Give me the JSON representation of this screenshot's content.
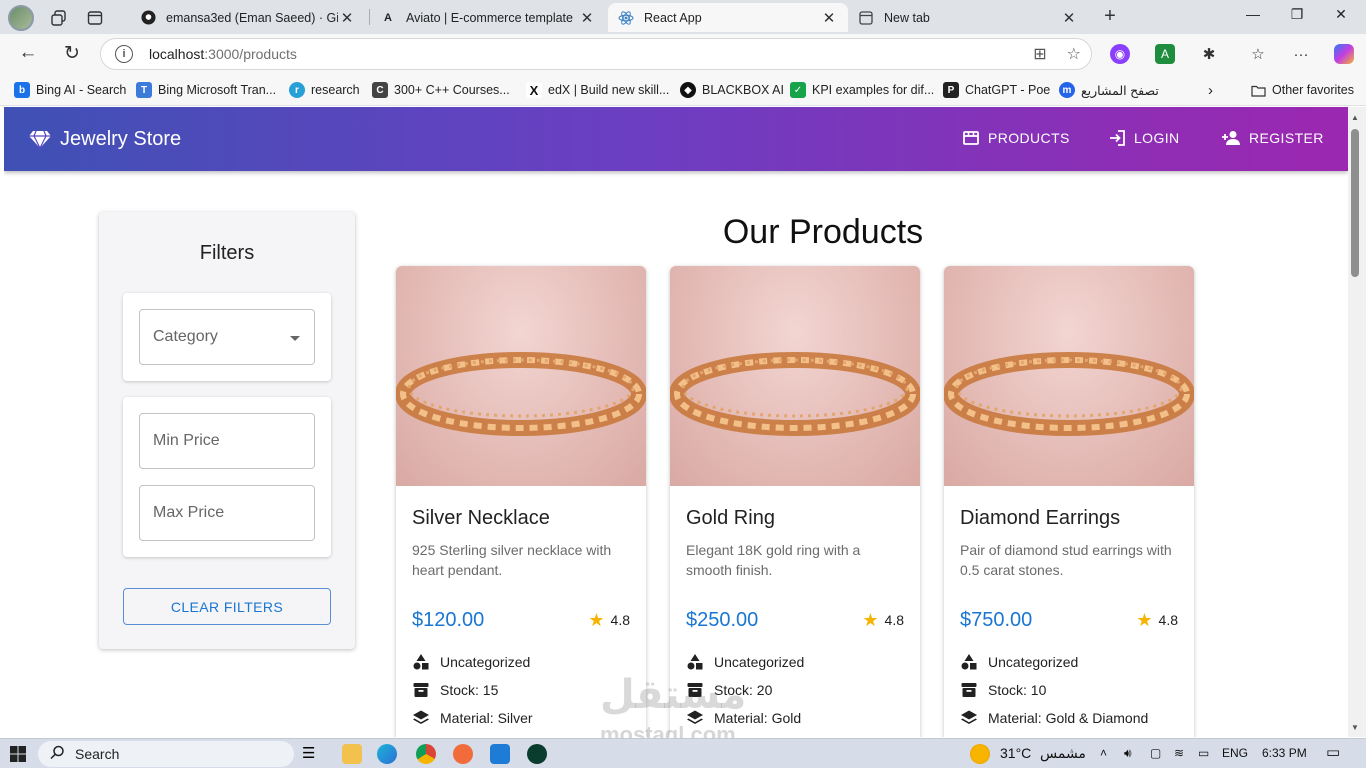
{
  "browser": {
    "tabs": [
      {
        "title": "emansa3ed (Eman Saeed) · GitHub",
        "favicon": "github-icon"
      },
      {
        "title": "Aviato | E-commerce template",
        "favicon": "aviato-icon"
      },
      {
        "title": "React App",
        "favicon": "react-icon",
        "active": true
      },
      {
        "title": "New tab",
        "favicon": "newtab-icon"
      }
    ],
    "url_host": "localhost",
    "url_path": ":3000/products",
    "favorites": [
      {
        "label": "Bing AI - Search",
        "icon": "bing-icon"
      },
      {
        "label": "Bing Microsoft Tran...",
        "icon": "translator-icon"
      },
      {
        "label": "research",
        "icon": "research-icon"
      },
      {
        "label": "300+ C++ Courses...",
        "icon": "courses-icon"
      },
      {
        "label": "edX | Build new skill...",
        "icon": "edx-icon"
      },
      {
        "label": "BLACKBOX AI",
        "icon": "blackbox-icon"
      },
      {
        "label": "KPI examples for dif...",
        "icon": "kpi-icon"
      },
      {
        "label": "ChatGPT - Poe",
        "icon": "poe-icon"
      },
      {
        "label": "تصفح المشاريع",
        "icon": "mostaql-icon"
      }
    ],
    "other_favorites": "Other favorites"
  },
  "app": {
    "brand": "Jewelry Store",
    "nav": {
      "products": "PRODUCTS",
      "login": "LOGIN",
      "register": "REGISTER"
    },
    "filters": {
      "title": "Filters",
      "category_placeholder": "Category",
      "min_price_placeholder": "Min Price",
      "max_price_placeholder": "Max Price",
      "clear_label": "CLEAR FILTERS"
    },
    "page_title": "Our Products",
    "products": [
      {
        "name": "Silver Necklace",
        "description": "925 Sterling silver necklace with heart pendant.",
        "price": "$120.00",
        "rating": "4.8",
        "category": "Uncategorized",
        "stock": "Stock: 15",
        "material": "Material: Silver"
      },
      {
        "name": "Gold Ring",
        "description": "Elegant 18K gold ring with a smooth finish.",
        "price": "$250.00",
        "rating": "4.8",
        "category": "Uncategorized",
        "stock": "Stock: 20",
        "material": "Material: Gold"
      },
      {
        "name": "Diamond Earrings",
        "description": "Pair of diamond stud earrings with 0.5 carat stones.",
        "price": "$750.00",
        "rating": "4.8",
        "category": "Uncategorized",
        "stock": "Stock: 10",
        "material": "Material: Gold & Diamond"
      }
    ]
  },
  "taskbar": {
    "search_label": "Search",
    "weather": "31°C",
    "weather_desc": "مشمس",
    "language": "ENG",
    "time": "6:33 PM"
  },
  "watermark": {
    "text": "مستقل",
    "domain": "mostaql.com"
  },
  "colors": {
    "appbar_start": "#3f51b5",
    "appbar_end": "#9c27b0",
    "price": "#1976d2",
    "star": "#f5b400"
  }
}
